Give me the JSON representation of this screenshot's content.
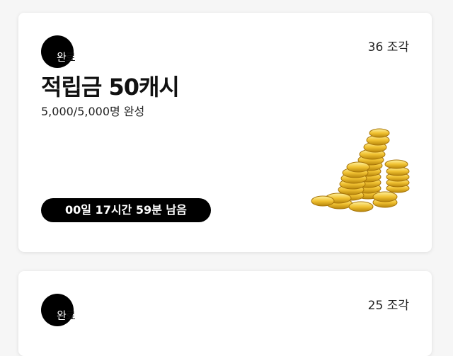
{
  "cards": [
    {
      "status_part1": "완",
      "status_part2": "료",
      "pieces": "36 조각",
      "title": "적립금 50캐시",
      "progress": "5,000/5,000명 완성",
      "timer": "00일 17시간 59분 남음",
      "image_icon": "gold-coins-icon"
    },
    {
      "status_part1": "완",
      "status_part2": "료",
      "pieces": "25 조각"
    }
  ]
}
